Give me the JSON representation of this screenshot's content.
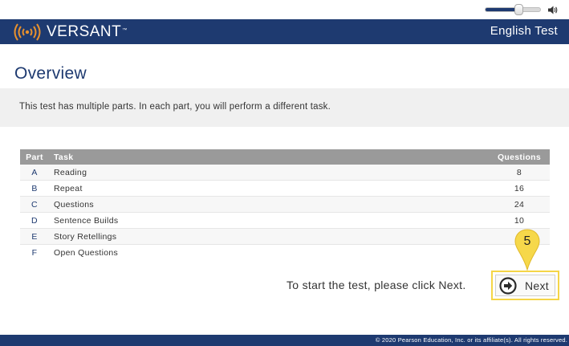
{
  "volume": {
    "level": 0.6,
    "accent_color": "#1e3a70"
  },
  "header": {
    "brand": "VERSANT",
    "trademark": "™",
    "title": "English Test",
    "background_color": "#1e3a70"
  },
  "page": {
    "title": "Overview",
    "intro": "This test has multiple parts. In each part, you will perform a different task."
  },
  "table": {
    "columns": {
      "part": "Part",
      "task": "Task",
      "questions": "Questions"
    },
    "rows": [
      {
        "part": "A",
        "task": "Reading",
        "questions": "8"
      },
      {
        "part": "B",
        "task": "Repeat",
        "questions": "16"
      },
      {
        "part": "C",
        "task": "Questions",
        "questions": "24"
      },
      {
        "part": "D",
        "task": "Sentence Builds",
        "questions": "10"
      },
      {
        "part": "E",
        "task": "Story Retellings",
        "questions": ""
      },
      {
        "part": "F",
        "task": "Open Questions",
        "questions": ""
      }
    ]
  },
  "footer_prompt": {
    "start_text": "To start the test, please click Next.",
    "next_label": "Next",
    "step_number": "5",
    "highlight_color": "#f5d547"
  },
  "footer": {
    "copyright": "© 2020 Pearson Education, Inc. or its affiliate(s). All rights reserved."
  }
}
